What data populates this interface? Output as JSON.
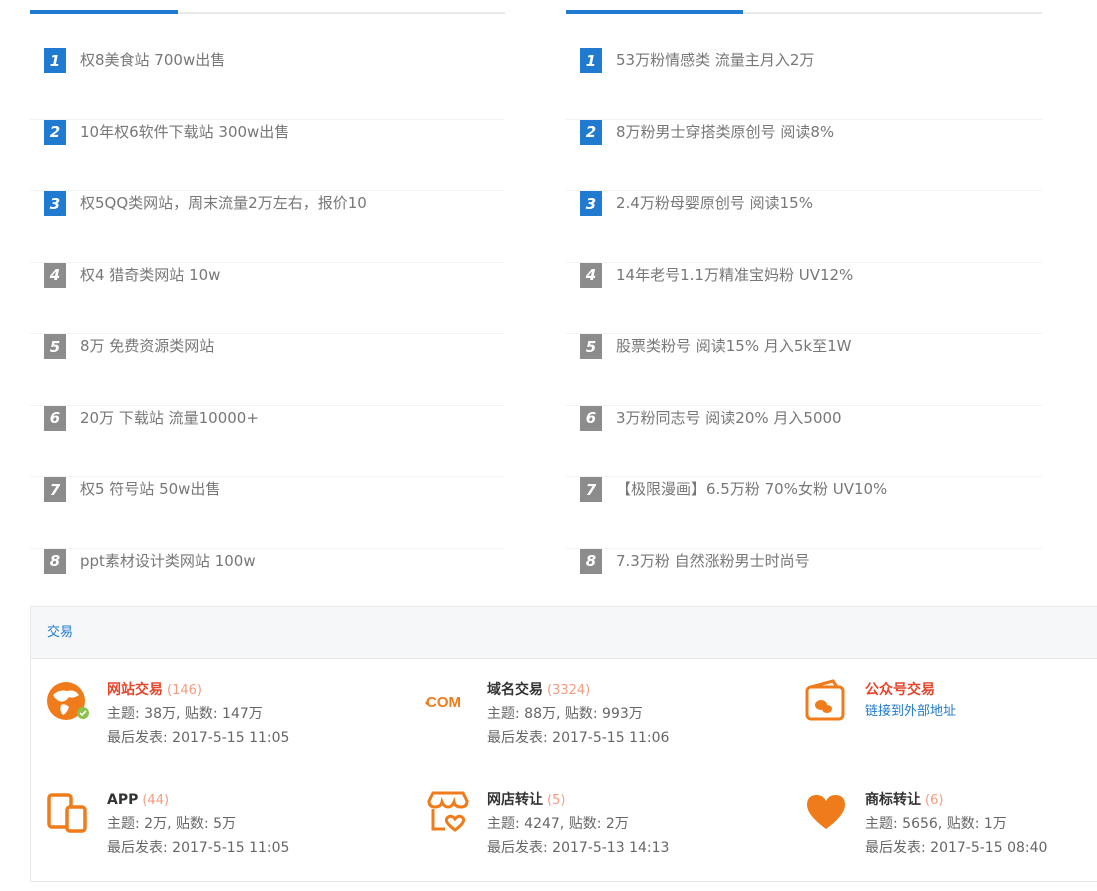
{
  "left_list": {
    "items": [
      {
        "num": "1",
        "text": "权8美食站 700w出售",
        "top": true
      },
      {
        "num": "2",
        "text": "10年权6软件下载站 300w出售",
        "top": true
      },
      {
        "num": "3",
        "text": "权5QQ类网站，周末流量2万左右，报价10",
        "top": true
      },
      {
        "num": "4",
        "text": "权4 猎奇类网站 10w",
        "top": false
      },
      {
        "num": "5",
        "text": "8万 免费资源类网站",
        "top": false
      },
      {
        "num": "6",
        "text": "20万 下载站 流量10000+",
        "top": false
      },
      {
        "num": "7",
        "text": "权5 符号站 50w出售",
        "top": false
      },
      {
        "num": "8",
        "text": "ppt素材设计类网站 100w",
        "top": false
      }
    ]
  },
  "right_list": {
    "items": [
      {
        "num": "1",
        "text": "53万粉情感类 流量主月入2万",
        "top": true
      },
      {
        "num": "2",
        "text": "8万粉男士穿搭类原创号 阅读8%",
        "top": true
      },
      {
        "num": "3",
        "text": "2.4万粉母婴原创号 阅读15%",
        "top": true
      },
      {
        "num": "4",
        "text": "14年老号1.1万精准宝妈粉 UV12%",
        "top": false
      },
      {
        "num": "5",
        "text": "股票类粉号 阅读15% 月入5k至1W",
        "top": false
      },
      {
        "num": "6",
        "text": "3万粉同志号 阅读20% 月入5000",
        "top": false
      },
      {
        "num": "7",
        "text": "【极限漫画】6.5万粉 70%女粉 UV10%",
        "top": false
      },
      {
        "num": "8",
        "text": "7.3万粉 自然涨粉男士时尚号",
        "top": false
      }
    ]
  },
  "trade": {
    "header": "交易",
    "items": [
      {
        "icon": "website-trade-icon",
        "title": "网站交易",
        "count": "(146)",
        "line1": "主题: 38万, 贴数: 147万",
        "line2": "最后发表: 2017-5-15 11:05",
        "color": "#f07b1a"
      },
      {
        "icon": "domain-com-icon",
        "title": "域名交易",
        "count": "(3324)",
        "line1": "主题: 88万, 贴数: 993万",
        "line2": "最后发表: 2017-5-15 11:06",
        "color": "#f07b1a"
      },
      {
        "icon": "wechat-account-icon",
        "title": "公众号交易",
        "link": "链接到外部地址",
        "color": "#f07b1a"
      },
      {
        "icon": "app-devices-icon",
        "title": "APP",
        "count": "(44)",
        "line1": "主题: 2万, 贴数: 5万",
        "line2": "最后发表: 2017-5-15 11:05",
        "color": "#f07b1a"
      },
      {
        "icon": "shop-transfer-icon",
        "title": "网店转让",
        "count": "(5)",
        "line1": "主题: 4247, 贴数: 2万",
        "line2": "最后发表: 2017-5-13 14:13",
        "color": "#f07b1a"
      },
      {
        "icon": "heart-trademark-icon",
        "title": "商标转让",
        "count": "(6)",
        "line1": "主题: 5656, 贴数: 1万",
        "line2": "最后发表: 2017-5-15 08:40",
        "color": "#f07b1a"
      }
    ]
  }
}
